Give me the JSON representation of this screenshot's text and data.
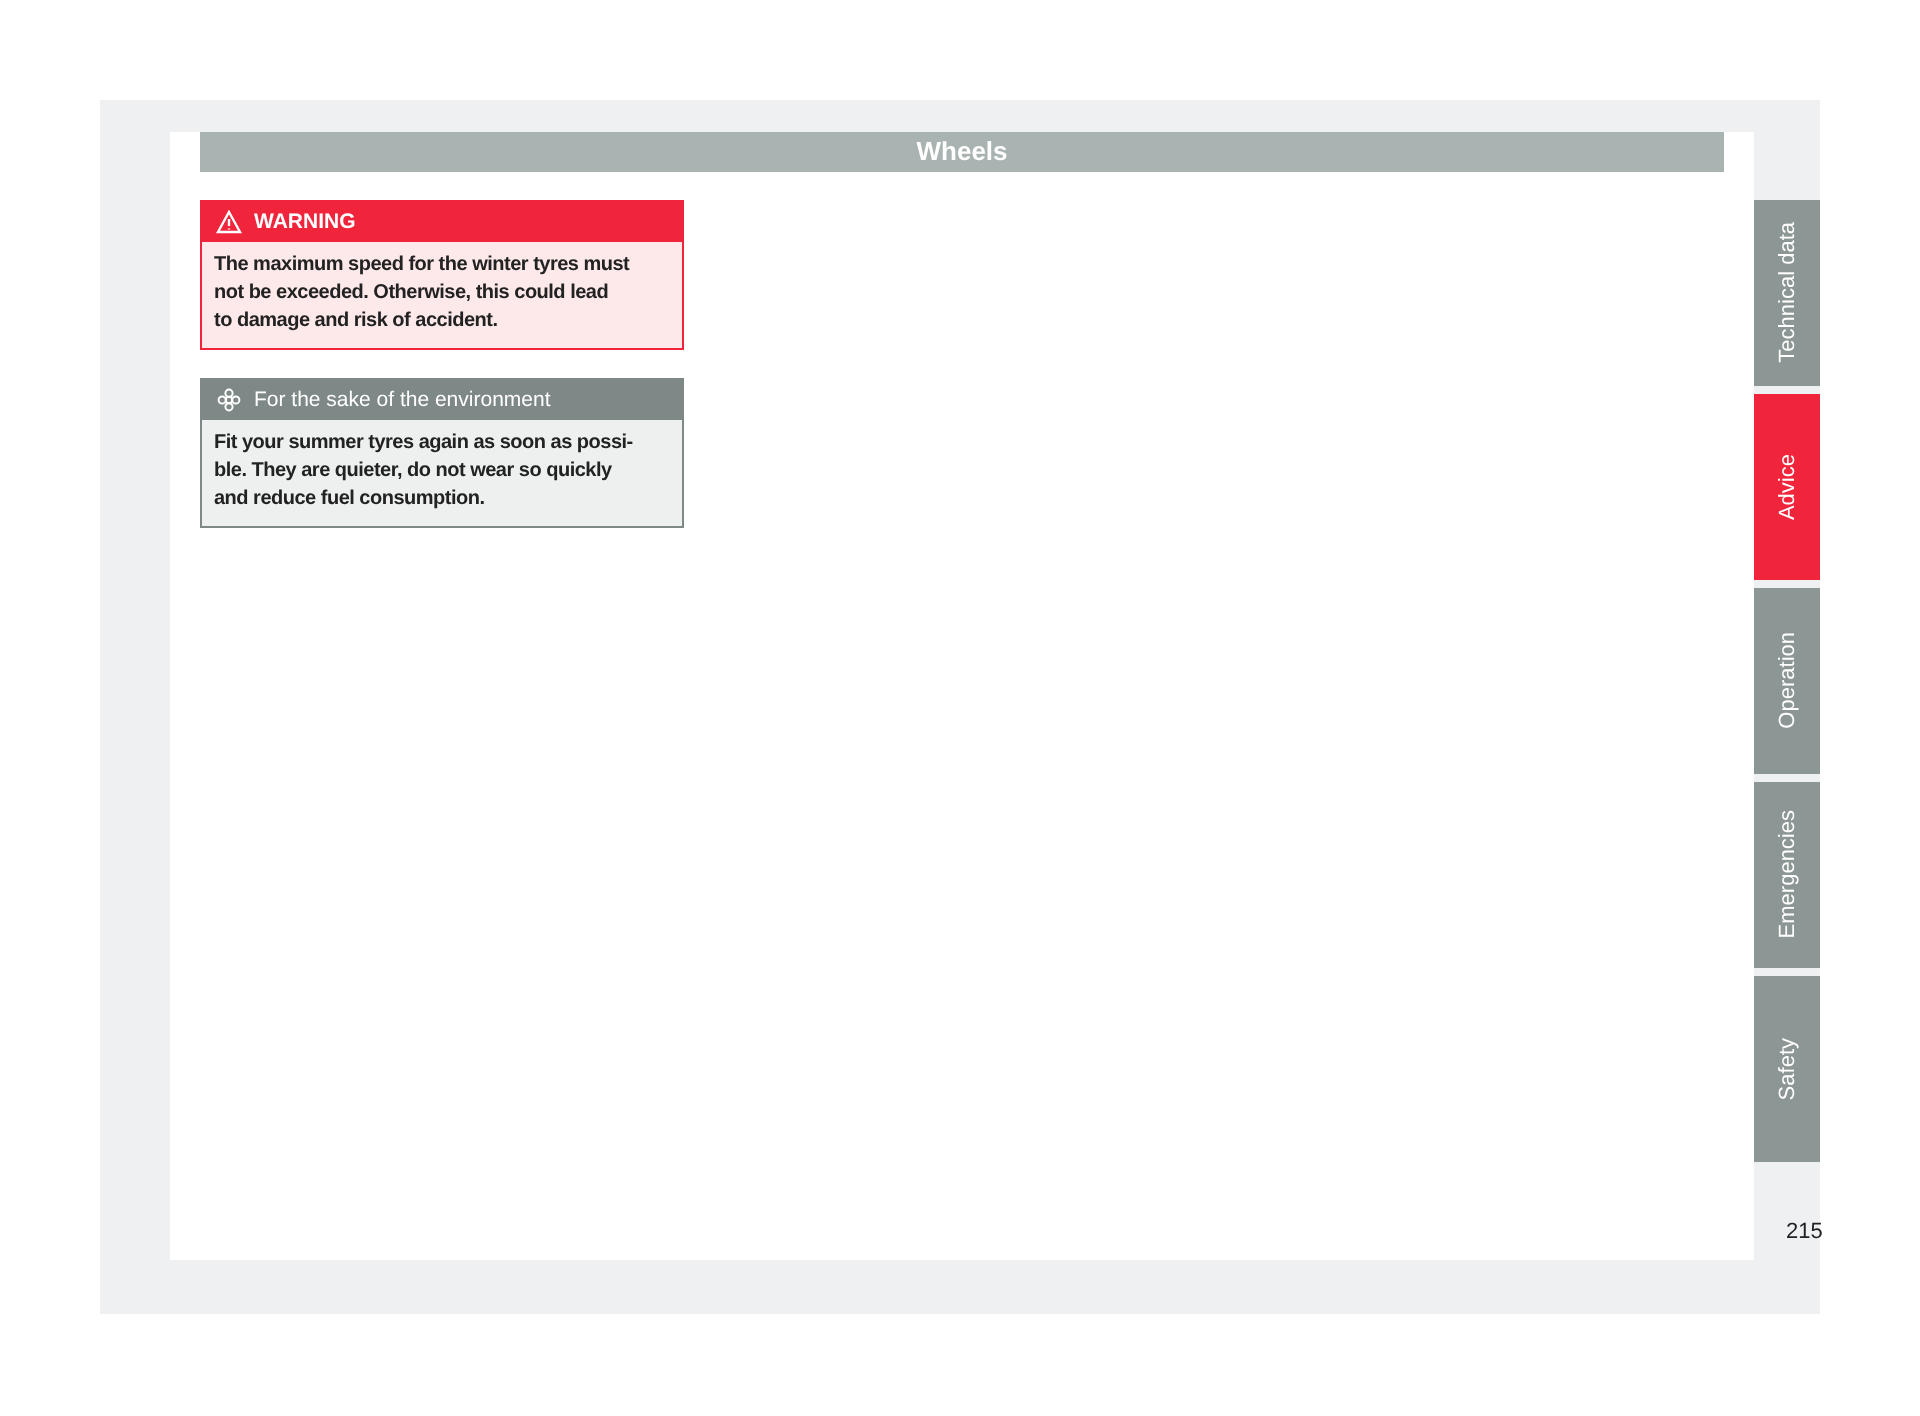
{
  "header": {
    "title": "Wheels"
  },
  "notices": [
    {
      "kind": "warning",
      "title": "WARNING",
      "lines": [
        "The maximum speed for the winter tyres must",
        "not be exceeded. Otherwise, this could lead",
        "to damage and risk of accident."
      ]
    },
    {
      "kind": "environment",
      "title": "For the sake of the environment",
      "lines": [
        "Fit your summer tyres again as soon as possi-",
        "ble. They are quieter, do not wear so quickly",
        "and reduce fuel consumption."
      ]
    }
  ],
  "side_tabs": [
    {
      "label": "Technical data",
      "selected": false
    },
    {
      "label": "Advice",
      "selected": true
    },
    {
      "label": "Operation",
      "selected": false
    },
    {
      "label": "Emergencies",
      "selected": false
    },
    {
      "label": "Safety",
      "selected": false
    }
  ],
  "page_number": "215"
}
